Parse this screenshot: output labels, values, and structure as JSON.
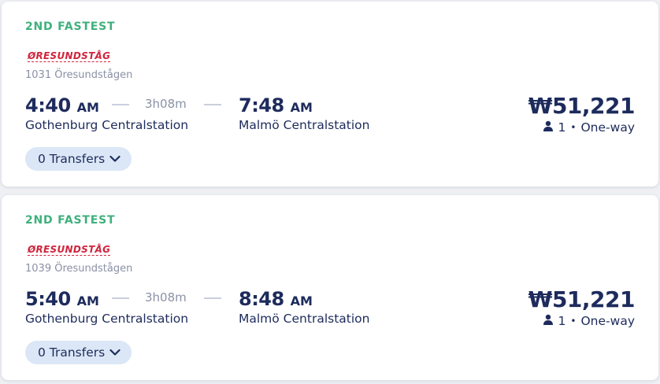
{
  "results": [
    {
      "badge": "2ND FASTEST",
      "operator_logo": "ØRESUNDSTÅG",
      "train_name": "1031 Öresundstågen",
      "departure": {
        "time": "4:40",
        "ampm": "AM",
        "station": "Gothenburg Centralstation"
      },
      "duration": "3h08m",
      "arrival": {
        "time": "7:48",
        "ampm": "AM",
        "station": "Malmö Centralstation"
      },
      "transfers_label": "0 Transfers",
      "price": "₩51,221",
      "passengers": "1",
      "separator": "•",
      "trip_type": "One-way"
    },
    {
      "badge": "2ND FASTEST",
      "operator_logo": "ØRESUNDSTÅG",
      "train_name": "1039 Öresundstågen",
      "departure": {
        "time": "5:40",
        "ampm": "AM",
        "station": "Gothenburg Centralstation"
      },
      "duration": "3h08m",
      "arrival": {
        "time": "8:48",
        "ampm": "AM",
        "station": "Malmö Centralstation"
      },
      "transfers_label": "0 Transfers",
      "price": "₩51,221",
      "passengers": "1",
      "separator": "•",
      "trip_type": "One-way"
    }
  ],
  "colors": {
    "badge": "#3fb07c",
    "logo": "#d0243d",
    "text": "#1d2b5c",
    "muted": "#8a91a6",
    "pill": "#dbe7f6"
  }
}
